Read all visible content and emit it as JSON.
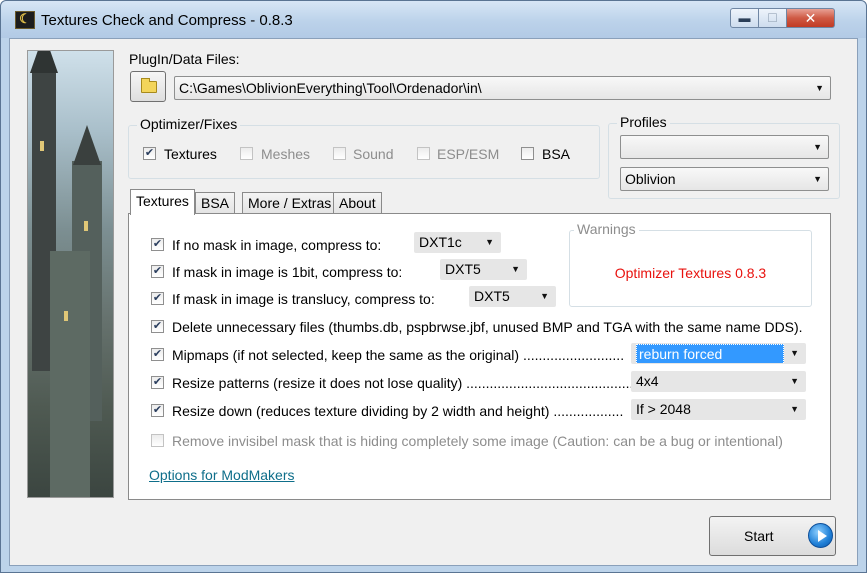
{
  "window": {
    "title": "Textures Check and Compress - 0.8.3",
    "app_icon": "app-logo-icon",
    "controls": {
      "minimize": "▬",
      "maximize": "☐",
      "close": "✕"
    }
  },
  "plugin": {
    "label": "PlugIn/Data Files:",
    "path": "C:\\Games\\OblivionEverything\\Tool\\Ordenador\\in\\"
  },
  "optimizer": {
    "legend": "Optimizer/Fixes",
    "items": [
      {
        "label": "Textures",
        "checked": true,
        "enabled": true
      },
      {
        "label": "Meshes",
        "checked": false,
        "enabled": false
      },
      {
        "label": "Sound",
        "checked": false,
        "enabled": false
      },
      {
        "label": "ESP/ESM",
        "checked": false,
        "enabled": false
      },
      {
        "label": "BSA",
        "checked": false,
        "enabled": true
      }
    ]
  },
  "profiles": {
    "legend": "Profiles",
    "first_value": "",
    "second_value": "Oblivion"
  },
  "tabs": [
    {
      "label": "Textures",
      "active": true
    },
    {
      "label": "BSA",
      "active": false
    },
    {
      "label": "More / Extras",
      "active": false
    },
    {
      "label": "About",
      "active": false
    }
  ],
  "textures_tab": {
    "options": [
      {
        "label": "If no mask in image, compress to:",
        "checked": true,
        "value": "DXT1c"
      },
      {
        "label": "If mask in image is 1bit, compress to:",
        "checked": true,
        "value": "DXT5"
      },
      {
        "label": "If mask in image is translucy, compress to:",
        "checked": true,
        "value": "DXT5"
      },
      {
        "label": "Delete unnecessary files (thumbs.db, pspbrwse.jbf, unused BMP and TGA with the same name DDS).",
        "checked": true
      },
      {
        "label": "Mipmaps (if not selected, keep the same as the original) ..........................",
        "checked": true,
        "value": "reburn forced"
      },
      {
        "label": "Resize patterns (resize it does not lose quality) ...........................................",
        "checked": true,
        "value": "4x4"
      },
      {
        "label": "Resize down (reduces texture dividing by 2 width and height) ..................",
        "checked": true,
        "value": "If > 2048"
      },
      {
        "label": "Remove invisibel mask that is hiding completely some image (Caution: can be a bug or intentional)",
        "checked": false,
        "enabled": false
      }
    ],
    "warnings_legend": "Warnings",
    "warnings_message": "Optimizer Textures 0.8.3",
    "modmakers_link": "Options for ModMakers"
  },
  "start_button": {
    "label": "Start",
    "icon": "play-arrow-icon"
  },
  "colors": {
    "warning_text": "#e8120e",
    "link": "#0e6e8a",
    "selection": "#3399ff",
    "window_frame": "#bcd3ea"
  }
}
